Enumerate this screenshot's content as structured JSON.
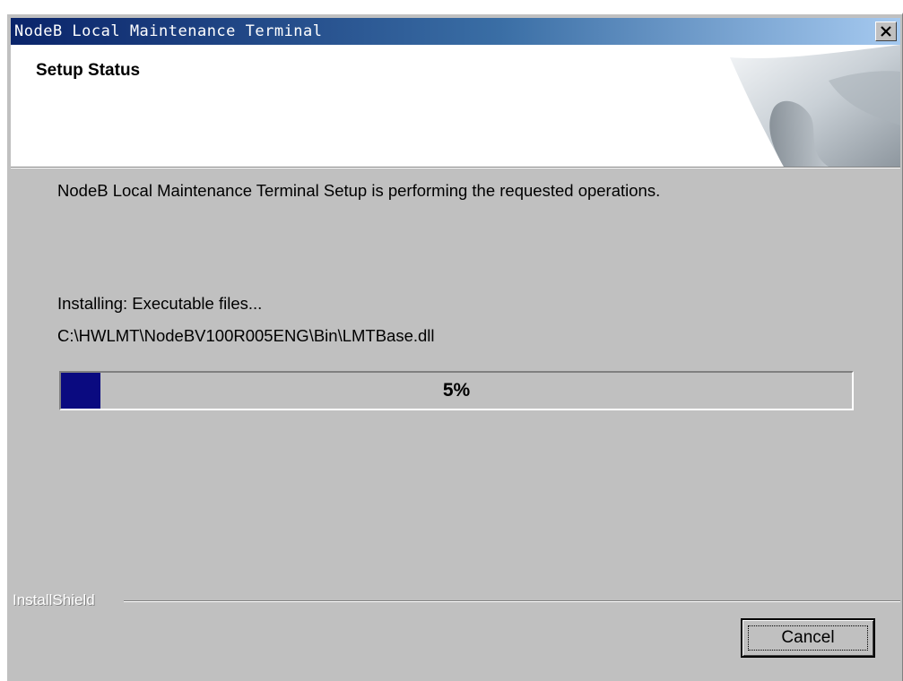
{
  "window": {
    "title": "NodeB Local Maintenance Terminal",
    "close_icon": "close-icon"
  },
  "header": {
    "heading": "Setup Status",
    "art_icon": "page-curl-art"
  },
  "main": {
    "description": "NodeB Local Maintenance Terminal Setup is performing the requested operations.",
    "status_text": "Installing: Executable files...",
    "file_path": "C:\\HWLMT\\NodeBV100R005ENG\\Bin\\LMTBase.dll",
    "progress": {
      "value": 0.05,
      "label": "5%",
      "fill_color": "#0a0a80"
    }
  },
  "footer": {
    "brand": "InstallShield",
    "cancel_label": "Cancel"
  },
  "colors": {
    "titlebar_start": "#0a246a",
    "titlebar_end": "#a6caf0",
    "dialog_background": "#c0c0c0"
  }
}
